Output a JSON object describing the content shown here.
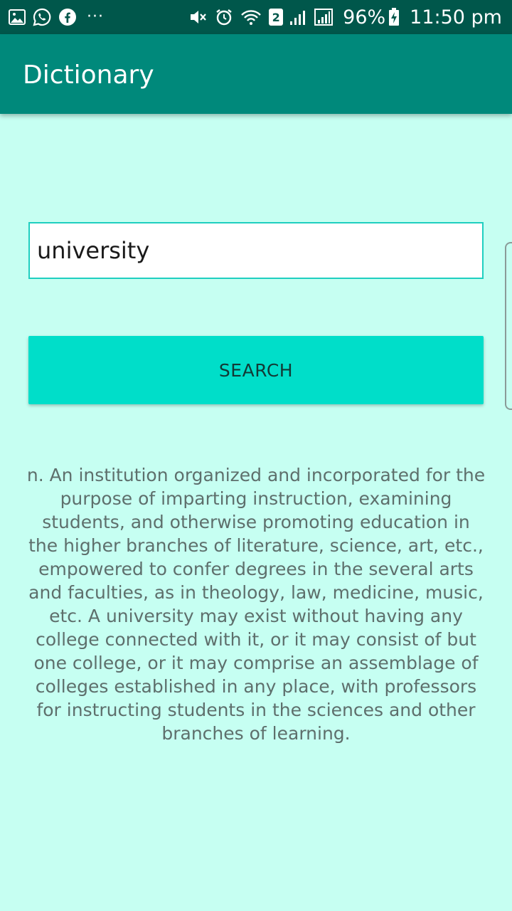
{
  "status_bar": {
    "icons_left": [
      "gallery-icon",
      "whatsapp-icon",
      "facebook-icon"
    ],
    "more": "···",
    "sim_badge": "2",
    "battery": "96%",
    "time": "11:50 pm"
  },
  "app_bar": {
    "title": "Dictionary"
  },
  "search": {
    "value": "university",
    "button_label": "SEARCH"
  },
  "result": {
    "definition": "n. An institution organized and incorporated for the purpose of imparting instruction, examining students, and otherwise promoting education in the higher branches of literature, science, art, etc., empowered to confer degrees in the several arts and faculties, as in theology, law, medicine, music, etc. A university may exist without having any college connected with it, or it may consist of but one college, or it may comprise an assemblage of colleges established in any place, with professors for instructing students in the sciences and other branches of learning."
  },
  "colors": {
    "status_bar": "#00574b",
    "app_bar": "#00897b",
    "background": "#c6fff2",
    "button": "#00dec9",
    "input_border": "#1fcfc0"
  }
}
